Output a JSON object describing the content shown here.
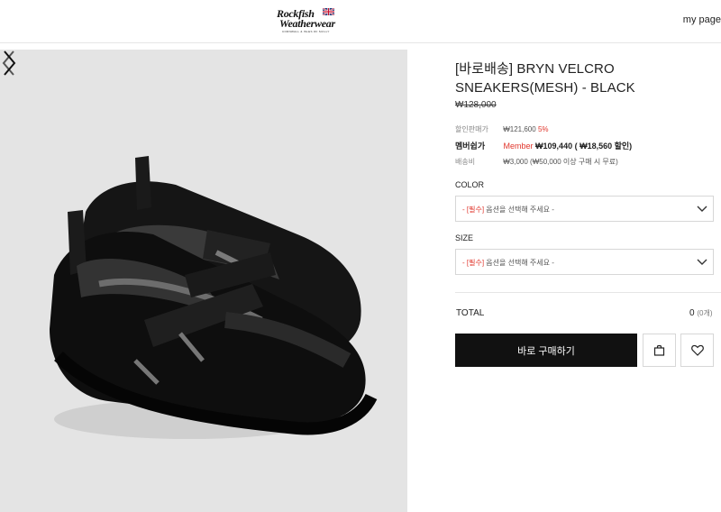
{
  "header": {
    "logo_line1": "Rockfish",
    "logo_line2": "Weatherwear",
    "logo_sub": "CORNWALL & ISLES OF SCILLY",
    "my_page": "my page"
  },
  "product": {
    "title": "[바로배송] BRYN VELCRO SNEAKERS(MESH) - BLACK",
    "original_price": "₩128,000",
    "sale_label": "할인판매가",
    "sale_price": "₩121,600",
    "sale_discount": "5%",
    "member_label": "멤버쉽가",
    "member_word": "Member",
    "member_price": "₩109,440",
    "member_saving": "( ₩18,560 할인)",
    "shipping_label": "배송비",
    "shipping_value": "₩3,000 (₩50,000 이상 구매 시 무료)"
  },
  "options": {
    "color_label": "COLOR",
    "size_label": "SIZE",
    "placeholder_prefix": "- [필수]",
    "placeholder_text": "옵션을 선택해 주세요 -"
  },
  "total": {
    "label": "TOTAL",
    "value": "0",
    "unit": "(0개)"
  },
  "buttons": {
    "buy": "바로 구매하기",
    "cart_icon": "shopping-bag-icon",
    "wish_icon": "heart-icon"
  },
  "gallery": {
    "prev_icon": "chevron-left-icon",
    "next_icon": "chevron-right-icon"
  },
  "colors": {
    "accent_red": "#e0352b",
    "button_black": "#111111",
    "image_bg": "#e4e4e4"
  }
}
